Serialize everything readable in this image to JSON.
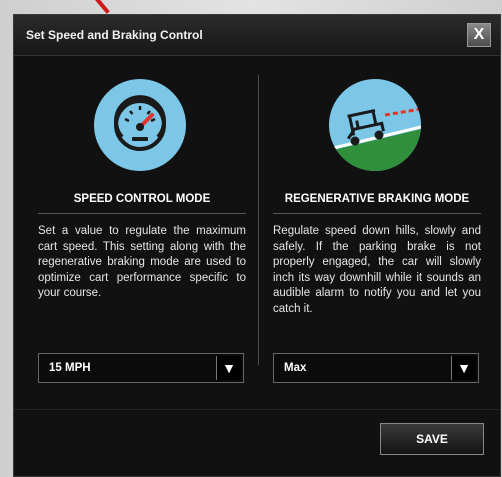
{
  "dialog": {
    "title": "Set Speed and Braking Control",
    "close_label": "X"
  },
  "speed_control": {
    "heading": "SPEED CONTROL MODE",
    "icon": "speedometer-icon",
    "description": "Set a value to regulate the maximum cart speed. This setting along with the regenerative braking mode are used to optimize cart performance specific to your course.",
    "selected": "15 MPH"
  },
  "regenerative_braking": {
    "heading": "REGENERATIVE BRAKING MODE",
    "icon": "golf-cart-downhill-icon",
    "description": "Regulate speed down hills, slowly and safely. If the parking brake is not properly engaged, the car will slowly inch its way downhill while it sounds an audible alarm to notify you and let you catch it.",
    "selected": "Max"
  },
  "footer": {
    "save_label": "SAVE"
  },
  "colors": {
    "icon_background": "#7cc7e8",
    "dialog_background": "#111111",
    "pointer_arrow": "#d01818"
  }
}
